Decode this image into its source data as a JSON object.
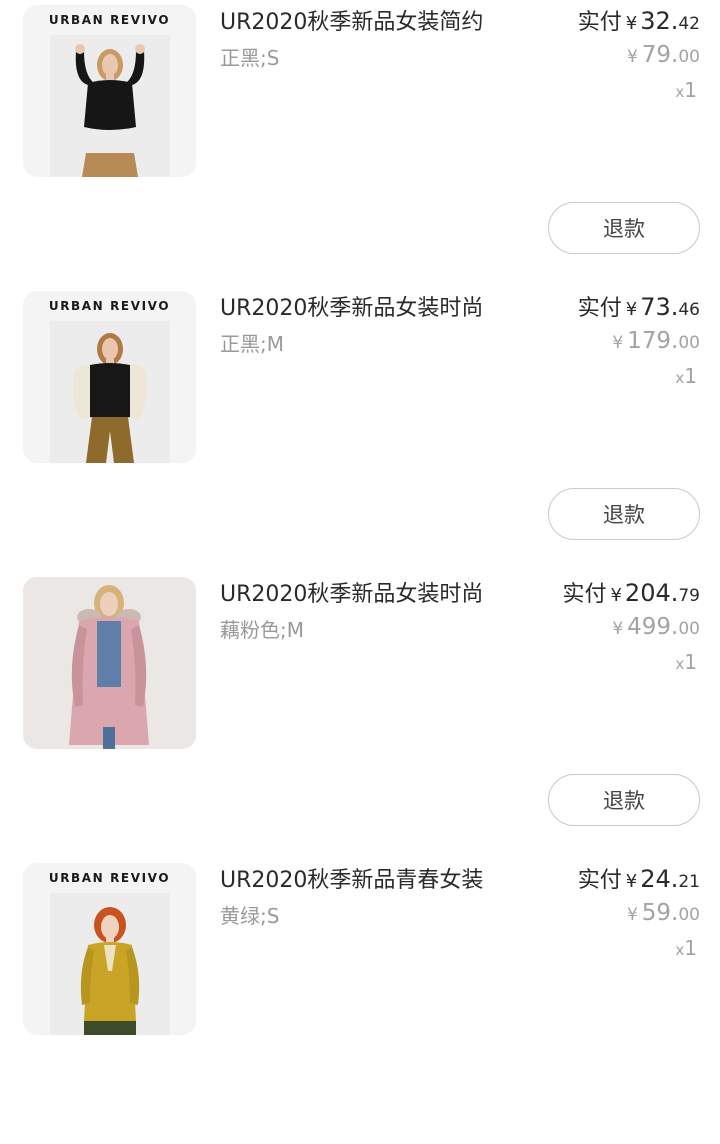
{
  "orders": [
    {
      "brand": "URBAN REVIVO",
      "title": "UR2020秋季新品女装简约",
      "variant": "正黑;S",
      "paid_label": "实付",
      "currency": "¥",
      "paid_int": "32.",
      "paid_dec": "42",
      "orig_int": "79.",
      "orig_dec": "00",
      "qty_prefix": "x",
      "qty": "1",
      "refund_label": "退款",
      "top_color": "#161616",
      "bottom_color": "#b68b55",
      "skin_color": "#e8c8b0",
      "hair_color": "#c99a62"
    },
    {
      "brand": "URBAN REVIVO",
      "title": "UR2020秋季新品女装时尚",
      "variant": "正黑;M",
      "paid_label": "实付",
      "currency": "¥",
      "paid_int": "73.",
      "paid_dec": "46",
      "orig_int": "179.",
      "orig_dec": "00",
      "qty_prefix": "x",
      "qty": "1",
      "refund_label": "退款",
      "top_color": "#171717",
      "sleeve_color": "#eee6d6",
      "bottom_color": "#8e6a2c",
      "skin_color": "#e9c6ad",
      "hair_color": "#b07a44"
    },
    {
      "brand": "",
      "title": "UR2020秋季新品女装时尚",
      "variant": "藕粉色;M",
      "paid_label": "实付",
      "currency": "¥",
      "paid_int": "204.",
      "paid_dec": "79",
      "orig_int": "499.",
      "orig_dec": "00",
      "qty_prefix": "x",
      "qty": "1",
      "refund_label": "退款",
      "top_color": "#d9a7ad",
      "denim_color": "#5f7ea8",
      "skin_color": "#ecd0bd",
      "hair_color": "#d7b27a"
    },
    {
      "brand": "URBAN REVIVO",
      "title": "UR2020秋季新品青春女装",
      "variant": "黄绿;S",
      "paid_label": "实付",
      "currency": "¥",
      "paid_int": "24.",
      "paid_dec": "21",
      "orig_int": "59.",
      "orig_dec": "00",
      "qty_prefix": "x",
      "qty": "1",
      "refund_label": "",
      "top_color": "#c9a427",
      "bottom_color": "#3d4b2a",
      "skin_color": "#f0d3bf",
      "hair_color": "#c9531f"
    }
  ]
}
